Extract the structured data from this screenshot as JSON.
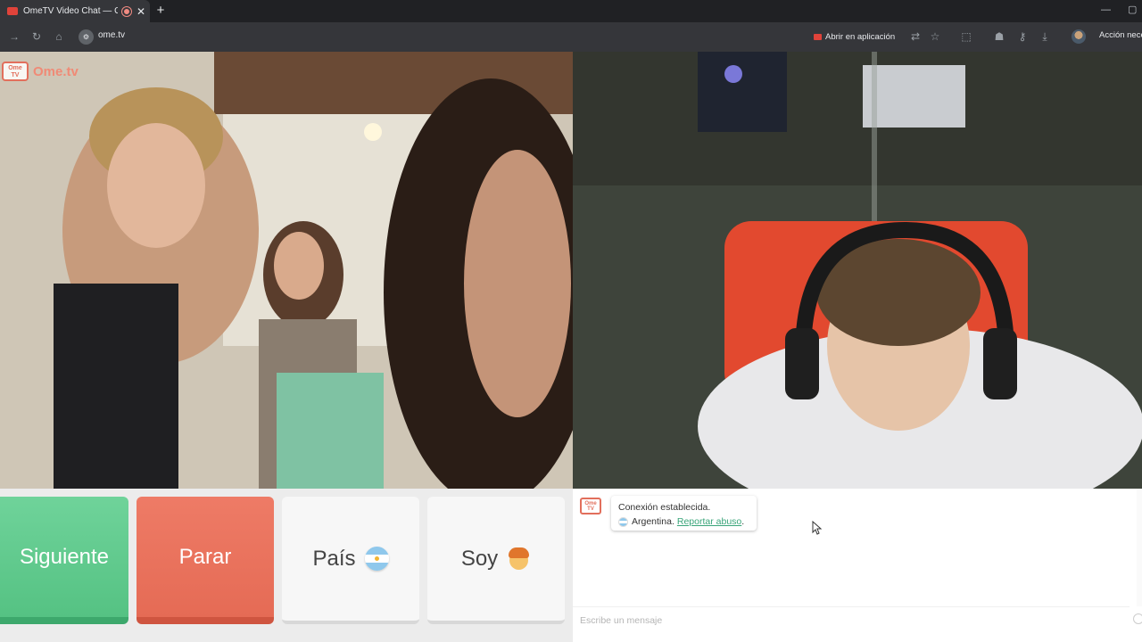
{
  "browser": {
    "tab_title": "OmeTV Video Chat — Ome.",
    "tab_close": "✕",
    "new_tab": "+",
    "minimize": "—",
    "maximize": "▢",
    "url": "ome.tv",
    "open_in_app": "Abrir en aplicación",
    "action_required": "Acción neces"
  },
  "branding": {
    "logo_badge": "Ome TV",
    "logo_text": "Ome.tv"
  },
  "controls": {
    "next_label": "Siguiente",
    "stop_label": "Parar",
    "country_label": "País",
    "country_flag": "argentina-flag-icon",
    "gender_label": "Soy",
    "gender_emoji": "boy-emoji-icon"
  },
  "chat": {
    "logo_badge": "Ome TV",
    "status": "Conexión establecida.",
    "country": "Argentina.",
    "report_link": "Reportar abuso",
    "report_suffix": ".",
    "input_placeholder": "Escribe un mensaje"
  },
  "colors": {
    "next_green": "#5ec98b",
    "stop_red": "#e8705a",
    "brand_coral": "#f08a76",
    "link_green": "#3aa57a"
  }
}
